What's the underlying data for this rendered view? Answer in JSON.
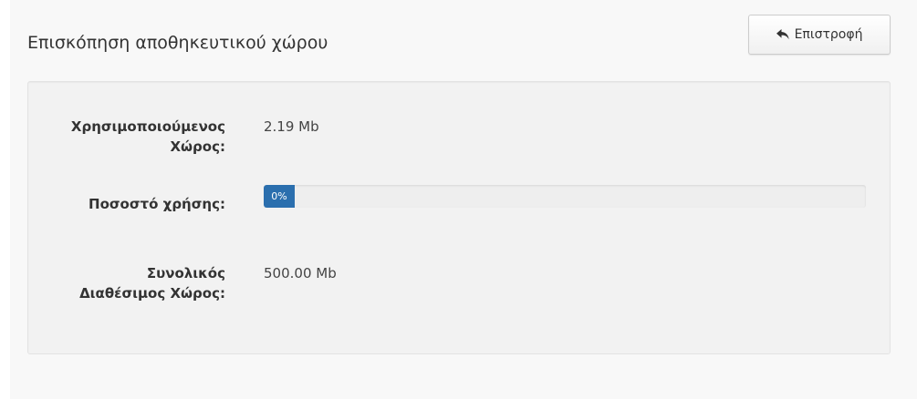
{
  "header": {
    "title": "Επισκόπηση αποθηκευτικού χώρου",
    "back_label": "Επιστροφή",
    "back_icon": "reply-arrow-icon"
  },
  "storage": {
    "used_label_line1": "Χρησιμοποιούμενος",
    "used_label_line2": "Χώρος:",
    "used_value": "2.19 Mb",
    "usage_label": "Ποσοστό χρήσης:",
    "usage_percent": 0,
    "usage_text": "0%",
    "total_label_line1": "Συνολικός",
    "total_label_line2": "Διαθέσιμος Χώρος:",
    "total_value": "500.00 Mb"
  },
  "colors": {
    "progress_fill": "#2b6fae"
  }
}
